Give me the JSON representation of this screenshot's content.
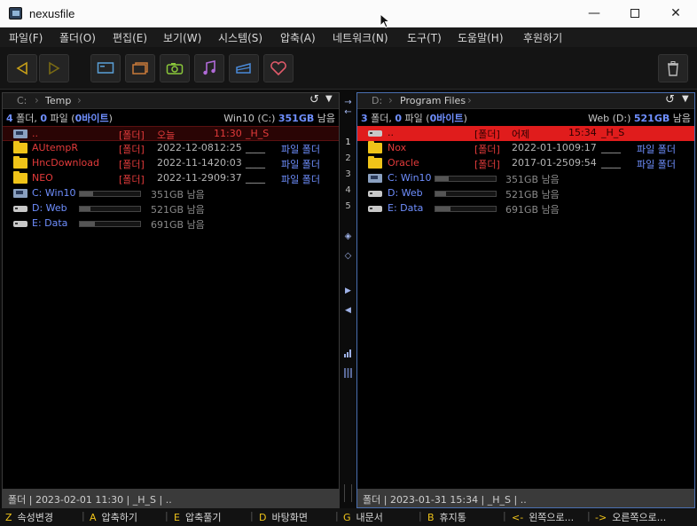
{
  "window": {
    "title": "nexusfile",
    "minimize_glyph": "—",
    "close_glyph": "✕"
  },
  "menu": [
    "파일(F)",
    "폴더(O)",
    "편집(E)",
    "보기(W)",
    "시스템(S)",
    "압축(A)",
    "네트워크(N)",
    "도구(T)",
    "도움말(H)",
    "후원하기"
  ],
  "toolbar": {
    "icons": [
      "back-arrow-icon",
      "forward-arrow-icon",
      "desktop-icon",
      "folder-window-icon",
      "camera-icon",
      "music-icon",
      "document-icon",
      "favorite-heart-icon",
      "trash-icon"
    ],
    "accent": "#f0c419"
  },
  "left_panel": {
    "drive": "C:",
    "path": "Temp",
    "refresh_glyph": "↺",
    "dropdown_glyph": "▼",
    "summary": {
      "folders": "4",
      "folders_suffix": " 폴더, ",
      "files": "0",
      "files_suffix": " 파일 (",
      "bytes": "0바이트",
      "close": ")",
      "volume_label": "Win10 (C:) ",
      "free": "351GB",
      "free_suffix": " 남음"
    },
    "rows": [
      {
        "name": "..",
        "type": "[폴더]",
        "date": "오늘",
        "time": "11:30",
        "attr": "_H_S",
        "kind": ""
      },
      {
        "name": "AUtempR",
        "type": "[폴더]",
        "date": "2022-12-08",
        "time": "12:25",
        "attr": "____",
        "kind": "파일 폴더"
      },
      {
        "name": "HncDownload",
        "type": "[폴더]",
        "date": "2022-11-14",
        "time": "20:03",
        "attr": "____",
        "kind": "파일 폴더"
      },
      {
        "name": "NEO",
        "type": "[폴더]",
        "date": "2022-11-29",
        "time": "09:37",
        "attr": "____",
        "kind": "파일 폴더"
      }
    ],
    "drives": [
      {
        "name": "C: Win10",
        "free": "351GB 남음",
        "used_fraction": 0.22
      },
      {
        "name": "D: Web",
        "free": "521GB 남음",
        "used_fraction": 0.18
      },
      {
        "name": "E: Data",
        "free": "691GB 남음",
        "used_fraction": 0.25
      }
    ],
    "status": "폴더 | 2023-02-01 11:30 | _H_S | .."
  },
  "right_panel": {
    "drive": "D:",
    "path": "Program Files",
    "refresh_glyph": "↺",
    "dropdown_glyph": "▼",
    "summary": {
      "folders": "3",
      "folders_suffix": " 폴더, ",
      "files": "0",
      "files_suffix": " 파일 (",
      "bytes": "0바이트",
      "close": ")",
      "volume_label": "Web (D:) ",
      "free": "521GB",
      "free_suffix": " 남음"
    },
    "rows": [
      {
        "name": "..",
        "type": "[폴더]",
        "date": "어제",
        "time": "15:34",
        "attr": "_H_S",
        "kind": ""
      },
      {
        "name": "Nox",
        "type": "[폴더]",
        "date": "2022-01-10",
        "time": "09:17",
        "attr": "____",
        "kind": "파일 폴더"
      },
      {
        "name": "Oracle",
        "type": "[폴더]",
        "date": "2017-01-25",
        "time": "09:54",
        "attr": "____",
        "kind": "파일 폴더"
      }
    ],
    "drives": [
      {
        "name": "C: Win10",
        "free": "351GB 남음",
        "used_fraction": 0.22
      },
      {
        "name": "D: Web",
        "free": "521GB 남음",
        "used_fraction": 0.18
      },
      {
        "name": "E: Data",
        "free": "691GB 남음",
        "used_fraction": 0.25
      }
    ],
    "status": "폴더 | 2023-01-31 15:34 | _H_S | .."
  },
  "middle_strip": {
    "copy_right": "→",
    "copy_left": "←",
    "tabs": [
      "1",
      "2",
      "3",
      "4",
      "5"
    ],
    "sync_glyph": "◈",
    "compare_glyph": "◇",
    "expand_right": "▶",
    "expand_left": "◀"
  },
  "fkeys": [
    {
      "key": "Z",
      "label": "속성변경"
    },
    {
      "key": "A",
      "label": "압축하기"
    },
    {
      "key": "E",
      "label": "압축풀기"
    },
    {
      "key": "D",
      "label": "바탕화면"
    },
    {
      "key": "G",
      "label": "내문서"
    },
    {
      "key": "B",
      "label": "휴지통"
    },
    {
      "key": "<-",
      "label": "왼쪽으로..."
    },
    {
      "key": "->",
      "label": "오른쪽으로..."
    }
  ]
}
